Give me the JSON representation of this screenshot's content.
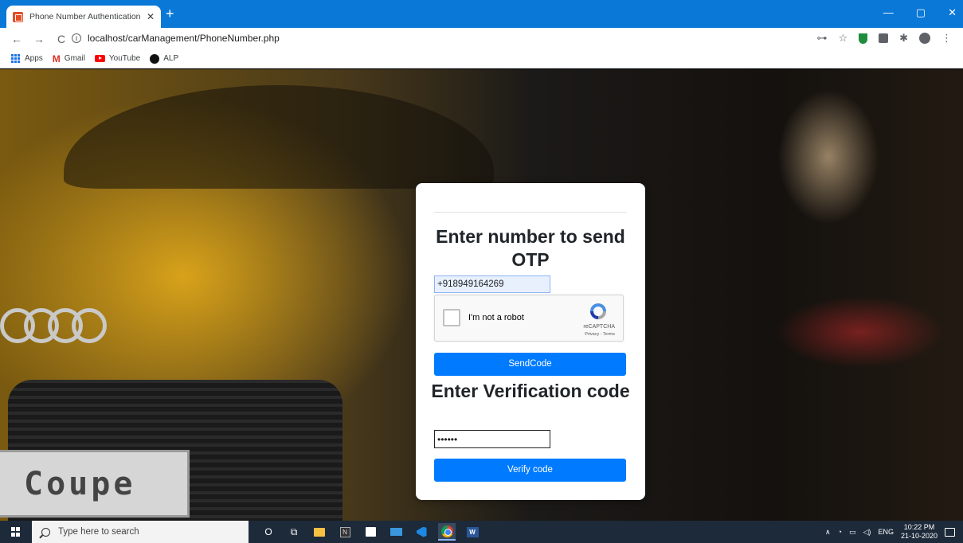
{
  "browser": {
    "tab_title": "Phone Number Authentication w",
    "tab_close": "✕",
    "new_tab": "+",
    "window_controls": {
      "minimize": "—",
      "maximize": "▢",
      "close": "✕"
    },
    "nav": {
      "back": "←",
      "forward": "→",
      "reload": "C",
      "info": "i"
    },
    "url": "localhost/carManagement/PhoneNumber.php",
    "toolbar_icons": {
      "key": "⊶",
      "star": "☆",
      "puzzle": "✱",
      "menu": "⋮"
    },
    "bookmarks": [
      {
        "label": "Apps"
      },
      {
        "label": "Gmail"
      },
      {
        "label": "YouTube"
      },
      {
        "label": "ALP"
      }
    ]
  },
  "page": {
    "plate_text": "Coupe",
    "card": {
      "heading_phone": "Enter number to send OTP",
      "phone_value": "+918949164269",
      "recaptcha": {
        "label": "I'm not a robot",
        "brand": "reCAPTCHA",
        "terms": "Privacy - Terms"
      },
      "send_button": "SendCode",
      "heading_code": "Enter Verification code",
      "code_value": "••••••",
      "verify_button": "Verify code"
    }
  },
  "taskbar": {
    "search_placeholder": "Type here to search",
    "cortana": "O",
    "taskview": "⧉",
    "notion_letter": "N",
    "word_letter": "W",
    "tray": {
      "chevron": "∧",
      "language": "ENG",
      "time": "10:22 PM",
      "date": "21-10-2020"
    }
  }
}
